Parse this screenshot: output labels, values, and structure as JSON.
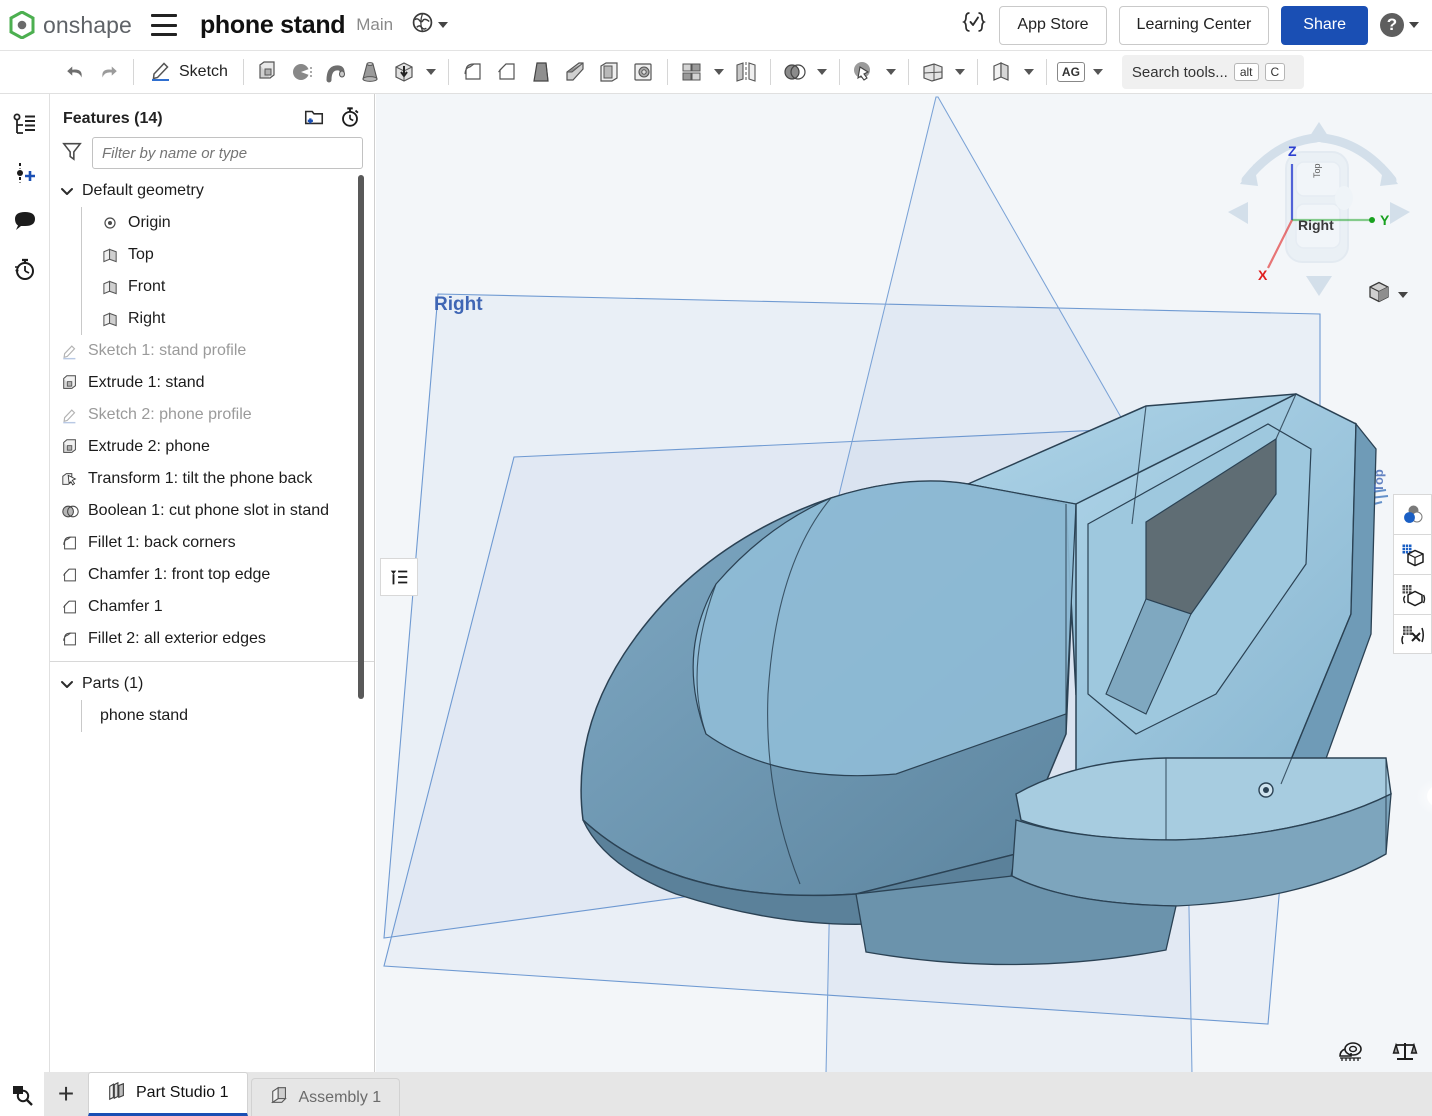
{
  "header": {
    "logo_text": "onshape",
    "logo_icon": "onshape-logo-icon",
    "menu_icon": "hamburger-menu-icon",
    "doc_title": "phone stand",
    "branch": "Main",
    "globe_icon": "globe-icon",
    "braces_icon": "featurescript-braces-icon",
    "app_store": "App Store",
    "learning_center": "Learning Center",
    "share": "Share",
    "help_glyph": "?",
    "share_color": "#1a4fb4"
  },
  "toolbar": {
    "undo_icon": "undo-arrow-icon",
    "redo_icon": "redo-arrow-icon",
    "sketch_label": "Sketch",
    "sketch_icon": "pencil-sketch-icon",
    "items": [
      {
        "name": "extrude-icon",
        "label": "Extrude"
      },
      {
        "name": "revolve-icon",
        "label": "Revolve"
      },
      {
        "name": "sweep-icon",
        "label": "Sweep"
      },
      {
        "name": "loft-icon",
        "label": "Loft"
      },
      {
        "name": "hole-icon",
        "label": "Hole"
      },
      {
        "name": "fillet-icon",
        "label": "Fillet"
      },
      {
        "name": "chamfer-icon",
        "label": "Chamfer"
      },
      {
        "name": "draft-icon",
        "label": "Draft"
      },
      {
        "name": "rib-icon",
        "label": "Rib"
      },
      {
        "name": "shell-icon",
        "label": "Shell"
      },
      {
        "name": "thicken-icon",
        "label": "Thicken"
      },
      {
        "name": "pattern-icon",
        "label": "Pattern"
      },
      {
        "name": "mirror-icon",
        "label": "Mirror"
      },
      {
        "name": "boolean-icon",
        "label": "Boolean"
      },
      {
        "name": "transform-icon",
        "label": "Transform"
      },
      {
        "name": "plane-icon",
        "label": "Plane"
      },
      {
        "name": "sheet-metal-icon",
        "label": "Sheet metal"
      }
    ],
    "ag_label": "AG",
    "search_placeholder": "Search tools...",
    "search_kbd_alt": "alt",
    "search_kbd_key": "C"
  },
  "rail": {
    "items": [
      {
        "name": "feature-list-icon",
        "label": "Feature list"
      },
      {
        "name": "add-variable-icon",
        "label": "Variables"
      },
      {
        "name": "comments-icon",
        "label": "Comments"
      },
      {
        "name": "history-icon",
        "label": "Version history"
      }
    ]
  },
  "features_panel": {
    "title": "Features (14)",
    "folder_icon": "new-folder-icon",
    "rollback_icon": "rollback-timer-icon",
    "filter_icon": "funnel-filter-icon",
    "filter_placeholder": "Filter by name or type",
    "filter_value": "",
    "default_geometry": {
      "label": "Default geometry",
      "expanded": true,
      "children": [
        {
          "label": "Origin",
          "icon": "origin-point-icon",
          "muted": false
        },
        {
          "label": "Top",
          "icon": "plane-icon",
          "muted": false
        },
        {
          "label": "Front",
          "icon": "plane-icon",
          "muted": false
        },
        {
          "label": "Right",
          "icon": "plane-icon",
          "muted": false
        }
      ]
    },
    "features": [
      {
        "label": "Sketch 1: stand profile",
        "icon": "sketch-icon",
        "muted": true
      },
      {
        "label": "Extrude 1: stand",
        "icon": "extrude-icon",
        "muted": false
      },
      {
        "label": "Sketch 2: phone profile",
        "icon": "sketch-icon",
        "muted": true
      },
      {
        "label": "Extrude 2: phone",
        "icon": "extrude-icon",
        "muted": false
      },
      {
        "label": "Transform 1: tilt the phone back",
        "icon": "transform-icon",
        "muted": false
      },
      {
        "label": "Boolean 1: cut phone slot in stand",
        "icon": "boolean-icon",
        "muted": false
      },
      {
        "label": "Fillet 1: back corners",
        "icon": "fillet-icon",
        "muted": false
      },
      {
        "label": "Chamfer 1: front top edge",
        "icon": "chamfer-icon",
        "muted": false
      },
      {
        "label": "Chamfer 1",
        "icon": "chamfer-icon",
        "muted": false
      },
      {
        "label": "Fillet 2: all exterior edges",
        "icon": "fillet-icon",
        "muted": false
      }
    ],
    "parts": {
      "label": "Parts (1)",
      "expanded": true,
      "items": [
        {
          "label": "phone stand"
        }
      ]
    }
  },
  "viewport": {
    "plane_label_right": "Right",
    "plane_label_top": "Top",
    "list_toggle_icon": "collapse-list-icon",
    "right_tools": [
      {
        "name": "appearance-icon",
        "label": "Appearance"
      },
      {
        "name": "section-view-icon",
        "label": "Section view"
      },
      {
        "name": "explode-view-icon",
        "label": "Explode view"
      },
      {
        "name": "render-icon",
        "label": "Render"
      }
    ],
    "view_cube": {
      "axis_z": "Z",
      "axis_y": "Y",
      "axis_x": "X",
      "face_front": "Right",
      "face_top": "Top",
      "color_z": "#2b3fd0",
      "color_y": "#18a11f",
      "color_x": "#e02020"
    },
    "display_style_icon": "shaded-cube-icon",
    "bottom_icons": [
      {
        "name": "measure-tape-icon",
        "label": "Measure"
      },
      {
        "name": "mass-properties-icon",
        "label": "Mass properties"
      }
    ],
    "model_color": "#8fc0da",
    "plane_color": "#5b86c8"
  },
  "tabs": {
    "zoom_icon": "zoom-to-fit-icon",
    "add_icon": "+",
    "items": [
      {
        "label": "Part Studio 1",
        "icon": "part-studio-icon",
        "active": true
      },
      {
        "label": "Assembly 1",
        "icon": "assembly-icon",
        "active": false
      }
    ]
  }
}
